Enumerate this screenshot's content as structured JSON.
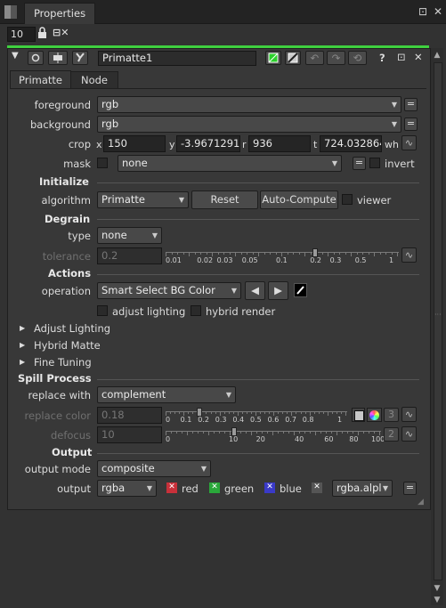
{
  "header": {
    "tab_label": "Properties",
    "float_icon": "float-icon",
    "close_label": "✕"
  },
  "toolbar": {
    "max_panels": "10",
    "lock_icon": "lock-icon",
    "clear_icon": "clear-panel-icon"
  },
  "node": {
    "name": "Primatte1"
  },
  "tabs": [
    {
      "label": "Primatte"
    },
    {
      "label": "Node"
    }
  ],
  "inputs": {
    "foreground_label": "foreground",
    "foreground_value": "rgb",
    "background_label": "background",
    "background_value": "rgb",
    "crop_label": "crop",
    "crop_x_label": "x",
    "crop_x": "150",
    "crop_y_label": "y",
    "crop_y": "-3.9671291",
    "crop_r_label": "r",
    "crop_r": "936",
    "crop_t_label": "t",
    "crop_t": "724.032864",
    "crop_wh_label": "wh",
    "mask_label": "mask",
    "mask_value": "none",
    "invert_label": "invert"
  },
  "initialize": {
    "section_label": "Initialize",
    "algorithm_label": "algorithm",
    "algorithm_value": "Primatte",
    "reset_label": "Reset",
    "autocompute_label": "Auto-Compute",
    "viewer_label": "viewer"
  },
  "degrain": {
    "section_label": "Degrain",
    "type_label": "type",
    "type_value": "none",
    "tolerance_label": "tolerance",
    "tolerance_value": "0.2",
    "ticks": [
      "0.01",
      "0.02",
      "0.03",
      "0.05",
      "0.1",
      "0.2",
      "0.3",
      "0.5",
      "1"
    ],
    "slider_level": 0.2
  },
  "actions": {
    "section_label": "Actions",
    "operation_label": "operation",
    "operation_value": "Smart Select BG Color",
    "adjust_lighting_label": "adjust lighting",
    "hybrid_render_label": "hybrid render"
  },
  "groups": [
    {
      "label": "Adjust Lighting"
    },
    {
      "label": "Hybrid Matte"
    },
    {
      "label": "Fine Tuning"
    }
  ],
  "spill": {
    "section_label": "Spill Process",
    "replace_with_label": "replace with",
    "replace_with_value": "complement",
    "replace_color_label": "replace color",
    "replace_color_value": "0.18",
    "replace_color_channels": "3",
    "rc_ticks": [
      "0",
      "0.1",
      "0.2",
      "0.3",
      "0.4",
      "0.5",
      "0.6",
      "0.7",
      "0.8",
      "1"
    ],
    "rc_level": 0.18,
    "defocus_label": "defocus",
    "defocus_value": "10",
    "defocus_channels": "2",
    "df_ticks": [
      "0",
      "10",
      "20",
      "40",
      "60",
      "80",
      "100"
    ],
    "df_level": 10
  },
  "output": {
    "section_label": "Output",
    "output_mode_label": "output mode",
    "output_mode_value": "composite",
    "output_label": "output",
    "output_value": "rgba",
    "red_label": "red",
    "green_label": "green",
    "blue_label": "blue",
    "alpha_value": "rgba.alpl"
  },
  "colors": {
    "accent_green": "#3fd03f",
    "red_check": "#c8303a",
    "green_check": "#2aa83a",
    "blue_check": "#3a3ac8"
  }
}
